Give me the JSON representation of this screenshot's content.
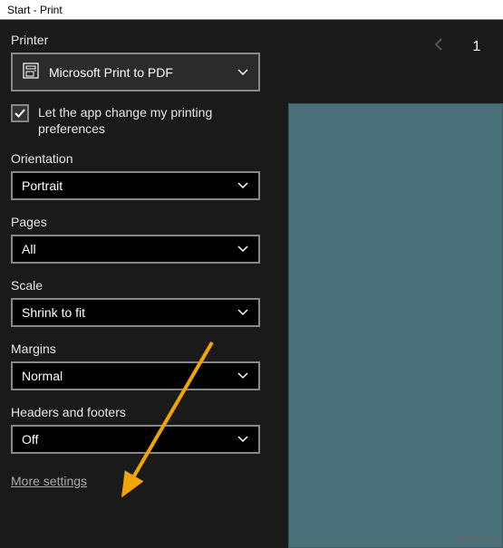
{
  "titlebar": "Start - Print",
  "printer": {
    "label": "Printer",
    "value": "Microsoft Print to PDF"
  },
  "preferences_checkbox": {
    "label": "Let the app change my printing preferences",
    "checked": true
  },
  "orientation": {
    "label": "Orientation",
    "value": "Portrait"
  },
  "pages": {
    "label": "Pages",
    "value": "All"
  },
  "scale": {
    "label": "Scale",
    "value": "Shrink to fit"
  },
  "margins": {
    "label": "Margins",
    "value": "Normal"
  },
  "headers_footers": {
    "label": "Headers and footers",
    "value": "Off"
  },
  "more_settings": "More settings",
  "preview": {
    "page_number": "1"
  },
  "watermark": "wsxdn.com"
}
